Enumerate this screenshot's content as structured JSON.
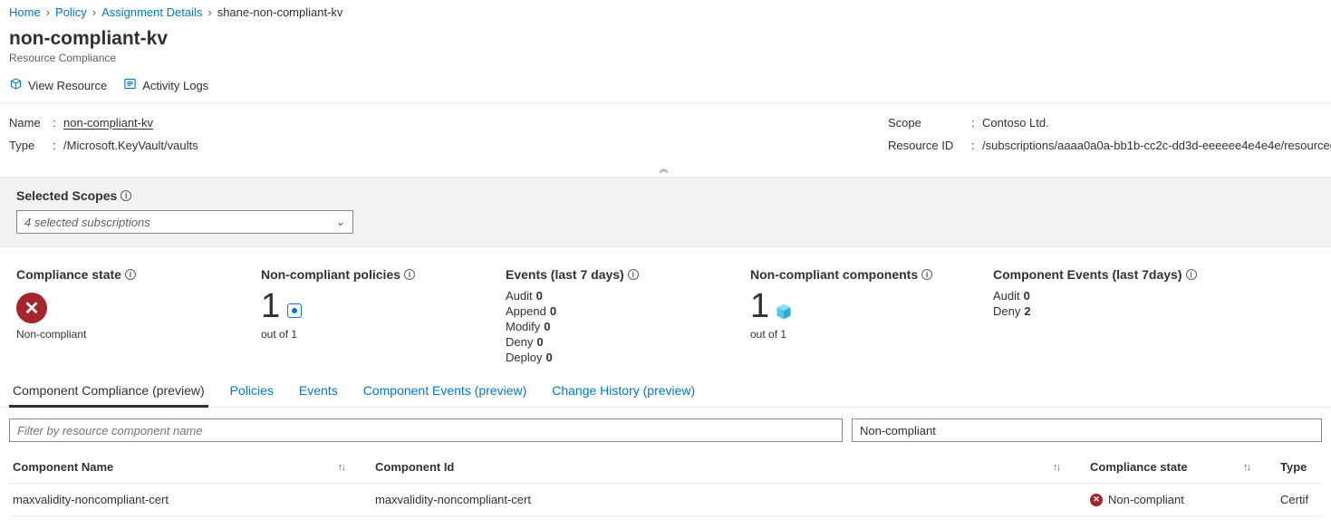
{
  "breadcrumb": {
    "items": [
      "Home",
      "Policy",
      "Assignment Details"
    ],
    "current": "shane-non-compliant-kv"
  },
  "page": {
    "title": "non-compliant-kv",
    "subtitle": "Resource Compliance"
  },
  "commands": {
    "view_resource": "View Resource",
    "activity_logs": "Activity Logs"
  },
  "props": {
    "name_label": "Name",
    "name_value": "non-compliant-kv",
    "type_label": "Type",
    "type_value": "/Microsoft.KeyVault/vaults",
    "scope_label": "Scope",
    "scope_value": "Contoso Ltd.",
    "resid_label": "Resource ID",
    "resid_value": "/subscriptions/aaaa0a0a-bb1b-cc2c-dd3d-eeeeee4e4e4e/resourcegro"
  },
  "scopes": {
    "header": "Selected Scopes",
    "selected": "4 selected subscriptions"
  },
  "stats": {
    "compliance_state": {
      "title": "Compliance state",
      "label": "Non-compliant"
    },
    "nc_policies": {
      "title": "Non-compliant policies",
      "big": "1",
      "under": "out of 1"
    },
    "events": {
      "title": "Events (last 7 days)",
      "lines": [
        {
          "k": "Audit",
          "v": "0"
        },
        {
          "k": "Append",
          "v": "0"
        },
        {
          "k": "Modify",
          "v": "0"
        },
        {
          "k": "Deny",
          "v": "0"
        },
        {
          "k": "Deploy",
          "v": "0"
        }
      ]
    },
    "nc_components": {
      "title": "Non-compliant components",
      "big": "1",
      "under": "out of 1"
    },
    "comp_events": {
      "title": "Component Events (last 7days)",
      "lines": [
        {
          "k": "Audit",
          "v": "0"
        },
        {
          "k": "Deny",
          "v": "2"
        }
      ]
    }
  },
  "tabs": {
    "items": [
      "Component Compliance (preview)",
      "Policies",
      "Events",
      "Component Events (preview)",
      "Change History (preview)"
    ],
    "active_index": 0
  },
  "filters": {
    "placeholder": "Filter by resource component name",
    "compliance_value": "Non-compliant"
  },
  "grid": {
    "cols": {
      "name": "Component Name",
      "id": "Component Id",
      "state": "Compliance state",
      "type": "Type"
    },
    "rows": [
      {
        "name": "maxvalidity-noncompliant-cert",
        "id": "maxvalidity-noncompliant-cert",
        "state": "Non-compliant",
        "type": "Certif"
      }
    ]
  }
}
